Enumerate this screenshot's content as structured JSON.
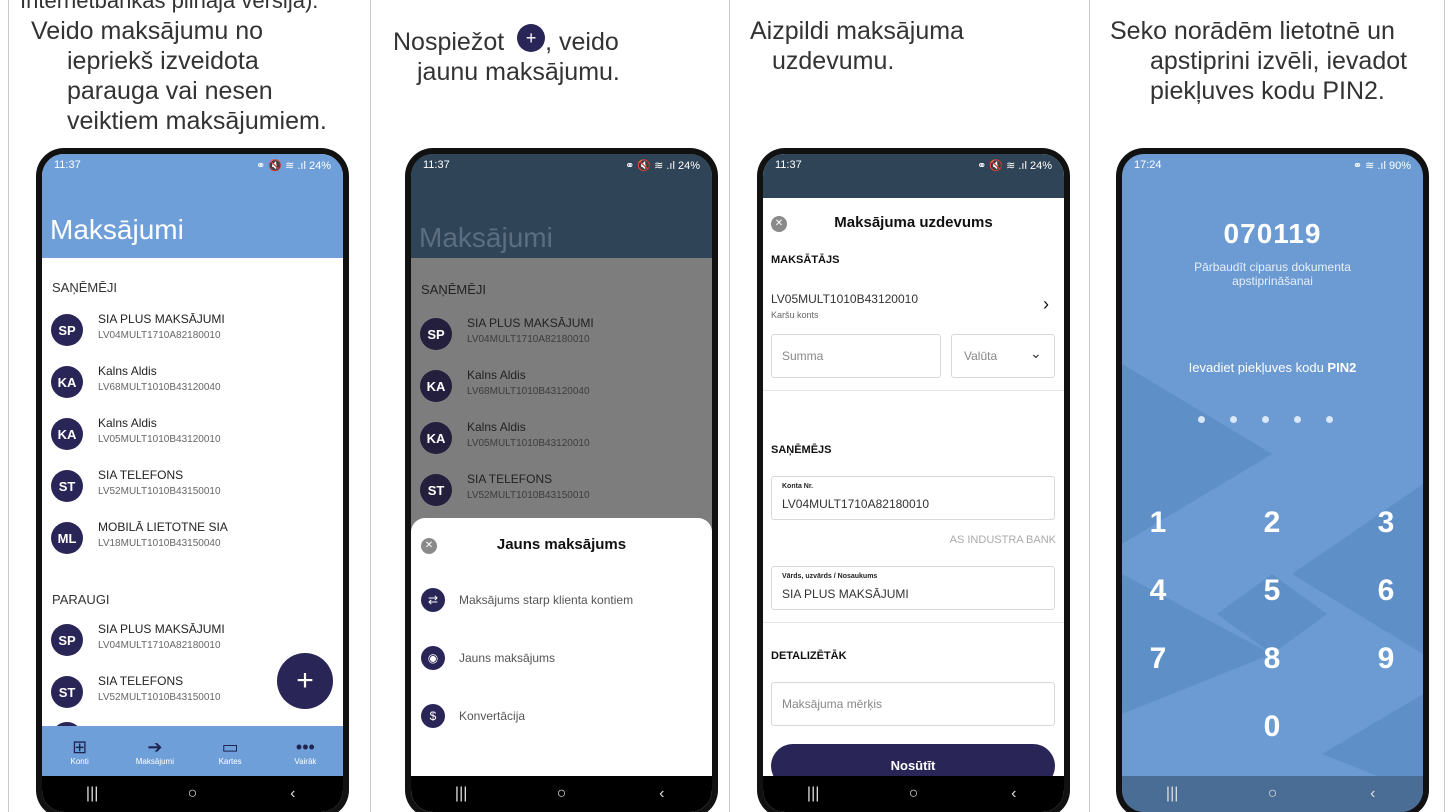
{
  "top_caption": "Internetbankas pilnajā versijā).",
  "captions": {
    "step1": [
      "Veido maksājumu no",
      "iepriekš izveidota",
      "parauga vai nesen",
      "veiktiem maksājumiem."
    ],
    "step2_a": "Nospiežot",
    "step2_b": ", veido",
    "step2_c": "jaunu maksājumu.",
    "step3": [
      "Aizpildi maksājuma",
      "uzdevumu."
    ],
    "step4": [
      "Seko norādēm lietotnē un",
      "apstiprini izvēli, ievadot",
      "piekļuves kodu PIN2."
    ]
  },
  "phone1": {
    "time": "11:37",
    "status": "⚭ 🔇 ≋ .ıl 24%",
    "title": "Maksājumi",
    "section_payees": "SAŅĒMĒJI",
    "payees": [
      {
        "initials": "SP",
        "name": "SIA PLUS MAKSĀJUMI",
        "account": "LV04MULT1710A82180010"
      },
      {
        "initials": "KA",
        "name": "Kalns Aldis",
        "account": "LV68MULT1010B43120040"
      },
      {
        "initials": "KA",
        "name": "Kalns Aldis",
        "account": "LV05MULT1010B43120010"
      },
      {
        "initials": "ST",
        "name": "SIA TELEFONS",
        "account": "LV52MULT1010B43150010"
      },
      {
        "initials": "ML",
        "name": "MOBILĀ LIETOTNE SIA",
        "account": "LV18MULT1010B43150040"
      }
    ],
    "section_templates": "PARAUGI",
    "templates": [
      {
        "initials": "SP",
        "name": "SIA PLUS MAKSĀJUMI",
        "account": "LV04MULT1710A82180010"
      },
      {
        "initials": "ST",
        "name": "SIA TELEFONS",
        "account": "LV52MULT1010B43150010"
      }
    ],
    "fab": "+",
    "tabs": [
      {
        "icon": "⊞",
        "label": "Konti"
      },
      {
        "icon": "➔",
        "label": "Maksājumi"
      },
      {
        "icon": "▭",
        "label": "Kartes"
      },
      {
        "icon": "•••",
        "label": "Vairāk"
      }
    ]
  },
  "phone2": {
    "time": "11:37",
    "status": "⚭ 🔇 ≋ .ıl 24%",
    "title": "Maksājumi",
    "section_payees": "SAŅĒMĒJI",
    "payees": [
      {
        "initials": "SP",
        "name": "SIA PLUS MAKSĀJUMI",
        "account": "LV04MULT1710A82180010"
      },
      {
        "initials": "KA",
        "name": "Kalns Aldis",
        "account": "LV68MULT1010B43120040"
      },
      {
        "initials": "KA",
        "name": "Kalns Aldis",
        "account": "LV05MULT1010B43120010"
      },
      {
        "initials": "ST",
        "name": "SIA TELEFONS",
        "account": "LV52MULT1010B43150010"
      }
    ],
    "sheet_title": "Jauns maksājums",
    "sheet_items": [
      {
        "icon": "⇄",
        "label": "Maksājums starp klienta kontiem"
      },
      {
        "icon": "◉",
        "label": "Jauns maksājums"
      },
      {
        "icon": "$",
        "label": "Konvertācija"
      }
    ]
  },
  "phone3": {
    "time": "11:37",
    "status": "⚭ 🔇 ≋ .ıl 24%",
    "title": "Maksājuma uzdevums",
    "payer_section": "MAKSĀTĀJS",
    "payer_account": "LV05MULT1010B43120010",
    "payer_type": "Karšu konts",
    "amount_placeholder": "Summa",
    "currency_placeholder": "Valūta",
    "payee_section": "SAŅĒMĒJS",
    "account_label": "Konta Nr.",
    "account_value": "LV04MULT1710A82180010",
    "bank_name": "AS INDUSTRA BANK",
    "name_label": "Vārds, uzvārds / Nosaukums",
    "name_value": "SIA PLUS MAKSĀJUMI",
    "details_section": "DETALIZĒTĀK",
    "purpose_placeholder": "Maksājuma mērķis",
    "send_label": "Nosūtīt"
  },
  "phone4": {
    "time": "17:24",
    "status": "⚭ ≋ .ıl 90%",
    "code": "070119",
    "verify_text": "Pārbaudīt ciparus dokumenta apstiprināšanai",
    "prompt_prefix": "Ievadiet piekļuves kodu ",
    "prompt_bold": "PIN2",
    "keys": [
      "1",
      "2",
      "3",
      "4",
      "5",
      "6",
      "7",
      "8",
      "9",
      "0"
    ]
  },
  "navbar": {
    "recents": "|||",
    "home": "○",
    "back": "‹"
  },
  "colors": {
    "navy": "#2a2557",
    "blue": "#6f9fd8",
    "dim_header": "#2f4557",
    "pin_bg": "#6b9bd2"
  }
}
